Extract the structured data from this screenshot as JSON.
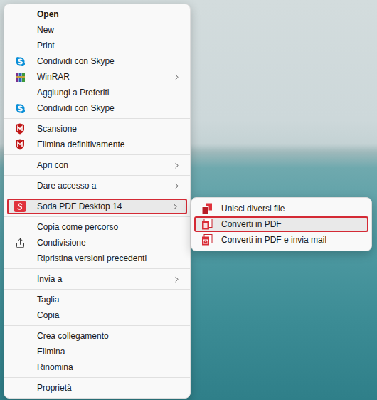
{
  "menu": {
    "groups": [
      [
        {
          "label": "Open",
          "kind": "plain",
          "default": true,
          "submenu": false,
          "selected": false
        },
        {
          "label": "New",
          "kind": "plain",
          "default": false,
          "submenu": false,
          "selected": false
        },
        {
          "label": "Print",
          "kind": "plain",
          "default": false,
          "submenu": false,
          "selected": false
        },
        {
          "label": "Condividi con Skype",
          "kind": "skype",
          "default": false,
          "submenu": false,
          "selected": false
        },
        {
          "label": "WinRAR",
          "kind": "winrar",
          "default": false,
          "submenu": true,
          "selected": false
        },
        {
          "label": "Aggiungi a Preferiti",
          "kind": "plain",
          "default": false,
          "submenu": false,
          "selected": false
        },
        {
          "label": "Condividi con Skype",
          "kind": "skype",
          "default": false,
          "submenu": false,
          "selected": false
        }
      ],
      [
        {
          "label": "Scansione",
          "kind": "mcafee",
          "default": false,
          "submenu": false,
          "selected": false
        },
        {
          "label": "Elimina definitivamente",
          "kind": "mcafee",
          "default": false,
          "submenu": false,
          "selected": false
        }
      ],
      [
        {
          "label": "Apri con",
          "kind": "plain",
          "default": false,
          "submenu": true,
          "selected": false
        }
      ],
      [
        {
          "label": "Dare accesso a",
          "kind": "plain",
          "default": false,
          "submenu": true,
          "selected": false
        }
      ],
      [
        {
          "label": "Soda PDF Desktop 14",
          "kind": "soda",
          "default": false,
          "submenu": true,
          "selected": true
        }
      ],
      [
        {
          "label": "Copia come percorso",
          "kind": "plain",
          "default": false,
          "submenu": false,
          "selected": false
        },
        {
          "label": "Condivisione",
          "kind": "share",
          "default": false,
          "submenu": false,
          "selected": false
        },
        {
          "label": "Ripristina versioni precedenti",
          "kind": "plain",
          "default": false,
          "submenu": false,
          "selected": false
        }
      ],
      [
        {
          "label": "Invia a",
          "kind": "plain",
          "default": false,
          "submenu": true,
          "selected": false
        }
      ],
      [
        {
          "label": "Taglia",
          "kind": "plain",
          "default": false,
          "submenu": false,
          "selected": false
        },
        {
          "label": "Copia",
          "kind": "plain",
          "default": false,
          "submenu": false,
          "selected": false
        }
      ],
      [
        {
          "label": "Crea collegamento",
          "kind": "plain",
          "default": false,
          "submenu": false,
          "selected": false
        },
        {
          "label": "Elimina",
          "kind": "plain",
          "default": false,
          "submenu": false,
          "selected": false
        },
        {
          "label": "Rinomina",
          "kind": "plain",
          "default": false,
          "submenu": false,
          "selected": false
        }
      ],
      [
        {
          "label": "Proprietà",
          "kind": "plain",
          "default": false,
          "submenu": false,
          "selected": false
        }
      ]
    ]
  },
  "submenu": {
    "items": [
      {
        "label": "Unisci diversi file",
        "kind": "merge",
        "selected": false
      },
      {
        "label": "Converti in PDF",
        "kind": "convert",
        "selected": true
      },
      {
        "label": "Converti in PDF e invia mail",
        "kind": "convert-mail",
        "selected": false
      }
    ]
  }
}
